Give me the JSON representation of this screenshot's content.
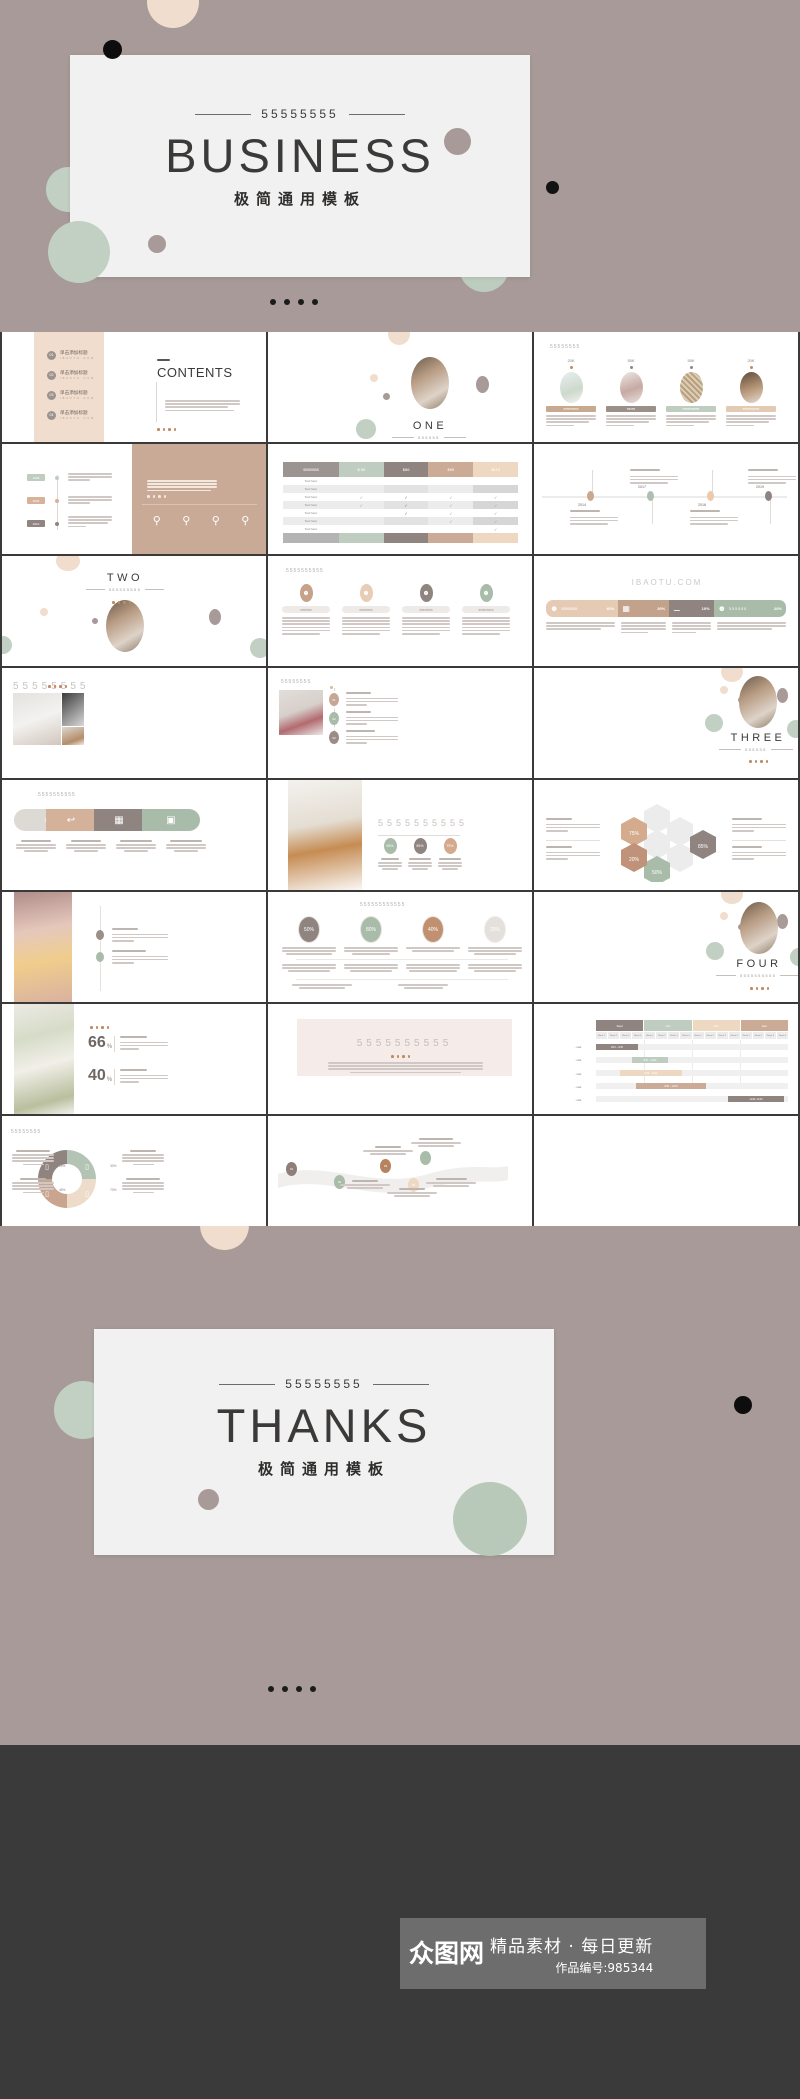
{
  "cover": {
    "kicker": "55555555",
    "title": "BUSINESS",
    "subtitle": "极简通用模板",
    "pager_dots": 4
  },
  "closing": {
    "kicker": "55555555",
    "title": "THANKS",
    "subtitle": "极简通用模板",
    "pager_dots": 4
  },
  "watermark": {
    "logo": "众图网",
    "tagline": "精品素材 · 每日更新",
    "work_id": "作品编号:985344"
  },
  "palette": {
    "cover_bg": "#a79a98",
    "card_bg": "#f1f1f1",
    "ink": "#3b3a38",
    "accent_beige": "#e8d5c4",
    "accent_tan": "#c9ab96",
    "accent_sage": "#b8c9b9",
    "accent_taupe": "#8f8480",
    "accent_blush": "#f3e6dd",
    "accent_rust": "#c08a63",
    "grid_gap": "#3a3a3a"
  },
  "slides": [
    {
      "id": 1,
      "row": 1,
      "col": 1,
      "kind": "contents",
      "heading": "CONTENTS",
      "items": [
        "单击添加标题",
        "单击添加标题",
        "单击添加标题",
        "单击添加标题"
      ],
      "item_sub": "I B A O T U . C O M",
      "item_nums": [
        "01",
        "02",
        "03",
        "04"
      ],
      "body": "Lorem ipsum dolor sit amet, consectetuer adipiscing elit. Maecenas porttitor congue massa."
    },
    {
      "id": 2,
      "row": 1,
      "col": 2,
      "kind": "section",
      "word": "ONE",
      "sub": "555555"
    },
    {
      "id": 3,
      "row": 1,
      "col": 3,
      "kind": "four-photo",
      "kicker": "55555555",
      "values": [
        "20K",
        "55K",
        "55K",
        "20K"
      ],
      "labels": [
        "555555555",
        "55555",
        "5555555555",
        "5555555555"
      ]
    },
    {
      "id": 4,
      "row": 2,
      "col": 1,
      "kind": "timeline-left",
      "years": [
        "2008",
        "2009",
        "2010"
      ]
    },
    {
      "id": 5,
      "row": 2,
      "col": 2,
      "kind": "price-table",
      "head": [
        "55555555",
        "$ 50",
        "$86",
        "$95",
        "$115"
      ],
      "rows": [
        "Text here",
        "Text here",
        "Text here",
        "Text here",
        "Text here",
        "Text here",
        "Text here"
      ]
    },
    {
      "id": 6,
      "row": 2,
      "col": 3,
      "kind": "timeline-h",
      "years": [
        "2014",
        "2017",
        "2018",
        "2019"
      ]
    },
    {
      "id": 7,
      "row": 3,
      "col": 1,
      "kind": "section",
      "word": "TWO",
      "sub": "555555555"
    },
    {
      "id": 8,
      "row": 3,
      "col": 2,
      "kind": "four-avatars",
      "kicker": "5555555555",
      "labels": [
        "5555555",
        "55555555",
        "55555555",
        "555555555"
      ]
    },
    {
      "id": 9,
      "row": 3,
      "col": 3,
      "kind": "banner-stats",
      "kicker": "IBAOTU.COM",
      "labels": [
        "55555555",
        "",
        "",
        "555555"
      ],
      "values": [
        "40%",
        "20%",
        "10%",
        "20%"
      ]
    },
    {
      "id": 10,
      "row": 4,
      "col": 1,
      "kind": "photo-collage",
      "kicker": "55555555"
    },
    {
      "id": 11,
      "row": 4,
      "col": 2,
      "kind": "photo-steps",
      "kicker": "55555555",
      "steps": [
        "01",
        "02",
        "03"
      ],
      "labels": [
        "5555555",
        "5555555",
        "55555555"
      ]
    },
    {
      "id": 12,
      "row": 4,
      "col": 3,
      "kind": "section",
      "word": "THREE",
      "sub": "555555"
    },
    {
      "id": 13,
      "row": 5,
      "col": 1,
      "kind": "ribbon-4",
      "kicker": "5555555555",
      "labels": [
        "5555555",
        "55555555",
        "555555555",
        "555555555"
      ]
    },
    {
      "id": 14,
      "row": 5,
      "col": 2,
      "kind": "photo-circles",
      "kicker": "5555555555",
      "values": [
        "95%",
        "85%",
        "75%"
      ],
      "labels": [
        "555555",
        "55555555",
        "55555555"
      ]
    },
    {
      "id": 15,
      "row": 5,
      "col": 3,
      "kind": "honeycomb",
      "values": [
        "75%",
        "85%",
        "50%",
        "20%"
      ],
      "labels": [
        "5555555",
        "55555555",
        "5555555",
        "55555555"
      ]
    },
    {
      "id": 16,
      "row": 6,
      "col": 1,
      "kind": "photo-list",
      "labels": [
        "5555555",
        "555555555"
      ]
    },
    {
      "id": 17,
      "row": 6,
      "col": 2,
      "kind": "rings-4",
      "kicker": "555555555555",
      "values": [
        "50%",
        "80%",
        "40%",
        "20%"
      ]
    },
    {
      "id": 18,
      "row": 6,
      "col": 3,
      "kind": "section",
      "word": "FOUR",
      "sub": "5555555555"
    },
    {
      "id": 19,
      "row": 7,
      "col": 1,
      "kind": "photo-pct",
      "values": [
        "66",
        "40"
      ],
      "unit": "%",
      "labels": [
        "55555555",
        "55555555"
      ]
    },
    {
      "id": 20,
      "row": 7,
      "col": 2,
      "kind": "quote-box",
      "kicker": "5555555555",
      "body": "Lorem ipsum dolor sit amet, consectetuer adipiscing elit. Maecenas porttitor congue massa."
    },
    {
      "id": 21,
      "row": 7,
      "col": 3,
      "kind": "gantt",
      "head": [
        "Sept",
        "Oct",
        "Nov",
        "Dec"
      ],
      "weeks": [
        "Week 1",
        "Week 2",
        "Week 3",
        "Week 4"
      ],
      "bars": [
        "9/01 – 9/15",
        "9/16 – 10/31",
        "9/16 – 11/30",
        "9/30 – 12/15",
        "11/20–12/20"
      ]
    },
    {
      "id": 22,
      "row": 8,
      "col": 1,
      "kind": "donut-4",
      "kicker": "55555555",
      "values": [
        "15%",
        "30%",
        "45%",
        "70%"
      ],
      "labels": [
        "555555555",
        "555555",
        "55555",
        "5555555"
      ]
    },
    {
      "id": 23,
      "row": 8,
      "col": 2,
      "kind": "wave-road",
      "labels": [
        "5555555",
        "555555555",
        "5555555",
        "5555555"
      ],
      "nodes": [
        "01",
        "02",
        "03",
        "04"
      ]
    },
    {
      "id": 24,
      "row": 8,
      "col": 3,
      "kind": "blank"
    }
  ]
}
